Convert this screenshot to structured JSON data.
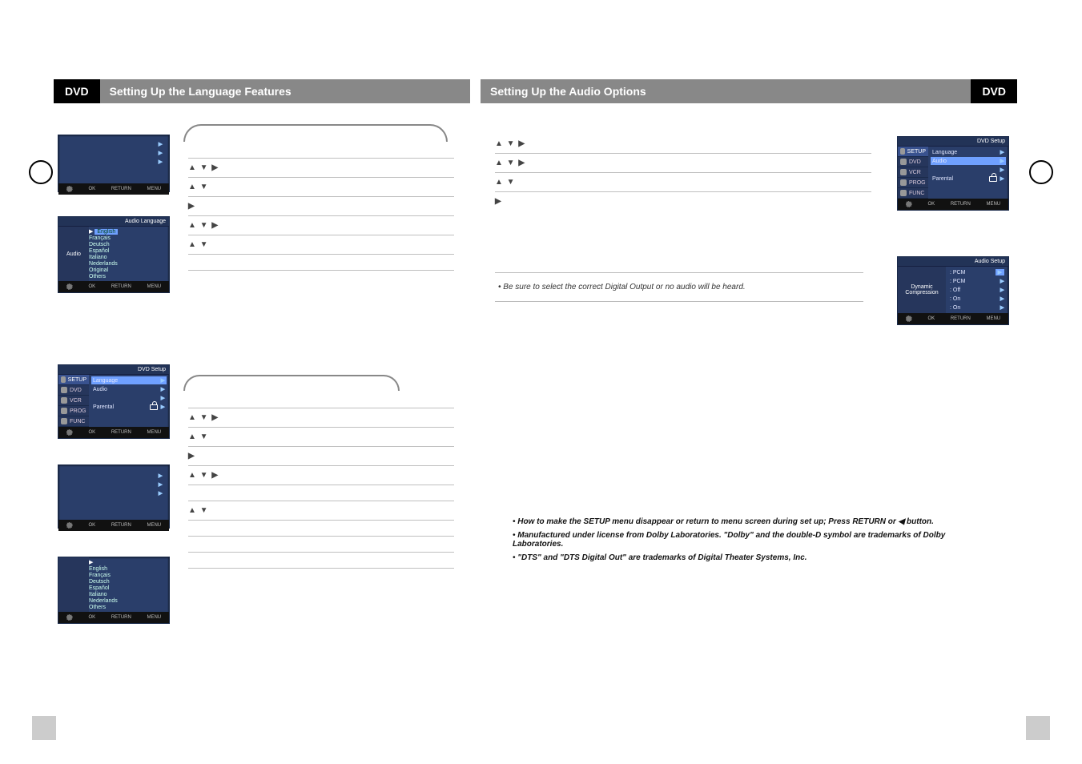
{
  "header": {
    "dvd_label": "DVD",
    "left_title": "Setting Up the Language Features",
    "right_title": "Setting Up the Audio Options"
  },
  "osd_common": {
    "footer_ok": "OK",
    "footer_return": "RETURN",
    "footer_menu": "MENU"
  },
  "osd1": {
    "rows": [
      "",
      "",
      ""
    ]
  },
  "osd2": {
    "title": "Audio Language",
    "left_label": "Audio",
    "items": [
      "English",
      "Français",
      "Deutsch",
      "Español",
      "Italiano",
      "Nederlands",
      "Original",
      "Others"
    ],
    "hi_prefix": "▶"
  },
  "osd3": {
    "title": "DVD Setup",
    "tabs": [
      "SETUP",
      "DVD",
      "VCR",
      "PROG",
      "FUNC"
    ],
    "rows": [
      {
        "label": "Language",
        "chev": "▶"
      },
      {
        "label": "Audio",
        "chev": "▶"
      },
      {
        "label": "",
        "chev": "▶"
      },
      {
        "label": "Parental",
        "chev": "▶",
        "lock": true
      }
    ]
  },
  "osd4": {
    "rows": [
      "",
      "",
      ""
    ]
  },
  "osd5": {
    "left_label": "",
    "items": [
      "",
      "English",
      "Français",
      "Deutsch",
      "Español",
      "Italiano",
      "Nederlands",
      "Others"
    ],
    "hi_prefix": "▶"
  },
  "osd_r1": {
    "title": "DVD Setup",
    "tabs": [
      "SETUP",
      "DVD",
      "VCR",
      "PROG",
      "FUNC"
    ],
    "rows": [
      {
        "label": "Language",
        "chev": "▶"
      },
      {
        "label": "Audio",
        "chev": "▶"
      },
      {
        "label": "",
        "chev": "▶"
      },
      {
        "label": "Parental",
        "chev": "▶",
        "lock": true
      }
    ]
  },
  "osd_r2": {
    "title": "Audio Setup",
    "left_label": "Dynamic Compression",
    "rows": [
      {
        "label": ": PCM",
        "chev": "▶",
        "hi": true
      },
      {
        "label": ": PCM",
        "chev": "▶"
      },
      {
        "label": ": Off",
        "chev": "▶"
      },
      {
        "label": ": On",
        "chev": "▶"
      },
      {
        "label": ": On",
        "chev": "▶"
      }
    ]
  },
  "steps_left_top": [
    "",
    "▲ ▼                          ▶",
    "▲ ▼",
    "▶",
    "▲ ▼                                              ▶",
    "▲ ▼",
    "",
    ""
  ],
  "steps_left_bottom": [
    "",
    "▲ ▼                      ▶",
    "▲ ▼",
    "▶",
    "▲ ▼                                              ▶",
    "",
    "▲ ▼",
    "",
    "",
    "",
    ""
  ],
  "steps_right": [
    "▲ ▼                    ▶",
    "▲ ▼                                              ▶",
    "▲ ▼",
    "▶"
  ],
  "note_box": {
    "text": "Be sure to select the correct Digital Output or no audio will be heard."
  },
  "bottom_bullets": [
    "How to make the SETUP menu disappear or return to menu screen during set up; Press RETURN or ◀ button.",
    "Manufactured under license from Dolby Laboratories. \"Dolby\" and the double-D symbol are trademarks of Dolby Laboratories.",
    "\"DTS\" and \"DTS Digital Out\" are trademarks of Digital Theater Systems, Inc."
  ]
}
